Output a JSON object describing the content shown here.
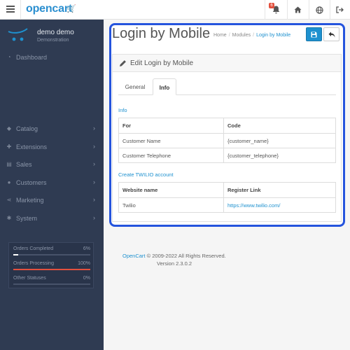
{
  "header": {
    "logo_text": "opencart",
    "logo_glyph": "🛒",
    "notification_count": "6",
    "icons": [
      "menu-icon",
      "bell-icon",
      "home-icon",
      "globe-icon",
      "logout-icon"
    ]
  },
  "sidebar": {
    "profile_name": "demo demo",
    "profile_role": "Demonstration",
    "items": [
      {
        "label": "Dashboard",
        "icon": "dashboard-icon",
        "glyph": "◔"
      },
      {
        "label": "Catalog",
        "icon": "tag-icon",
        "glyph": "◆"
      },
      {
        "label": "Extensions",
        "icon": "puzzle-icon",
        "glyph": "✚"
      },
      {
        "label": "Sales",
        "icon": "cart-icon",
        "glyph": "▤"
      },
      {
        "label": "Customers",
        "icon": "user-icon",
        "glyph": "●"
      },
      {
        "label": "Marketing",
        "icon": "share-icon",
        "glyph": "⋖"
      },
      {
        "label": "System",
        "icon": "cog-icon",
        "glyph": "✱"
      }
    ],
    "arrow": "›",
    "stats": [
      {
        "label": "Orders Completed",
        "value": "6%",
        "fraction": 0.06,
        "color": "#ffffff"
      },
      {
        "label": "Orders Processing",
        "value": "100%",
        "fraction": 1.0,
        "color": "#e3503e"
      },
      {
        "label": "Other Statuses",
        "value": "0%",
        "fraction": 0.0,
        "color": "#ffffff"
      }
    ]
  },
  "page": {
    "title": "Login by Mobile",
    "breadcrumb": [
      "Home",
      "Modules",
      "Login by Mobile"
    ],
    "breadcrumb_sep": "/"
  },
  "panel": {
    "heading": "Edit Login by Mobile",
    "tabs": [
      {
        "label": "General",
        "active": false
      },
      {
        "label": "Info",
        "active": true
      }
    ]
  },
  "info_section": {
    "title": "Info",
    "headers": [
      "For",
      "Code"
    ],
    "rows": [
      [
        "Customer Name",
        "{customer_name}"
      ],
      [
        "Customer Telephone",
        "{customer_telephone}"
      ]
    ]
  },
  "twilio_section": {
    "title": "Create TWILIO account",
    "headers": [
      "Website name",
      "Register Link"
    ],
    "rows": [
      [
        "Twilio",
        "https://www.twilio.com/"
      ]
    ]
  },
  "footer": {
    "brand": "OpenCart",
    "copyright": " © 2009-2022 All Rights Reserved.",
    "version": "Version 2.3.0.2"
  },
  "colors": {
    "accent": "#1e91cf",
    "sidebar_bg": "#2f3b52",
    "highlight_border": "#2554dd",
    "processing_bar": "#e3503e"
  }
}
